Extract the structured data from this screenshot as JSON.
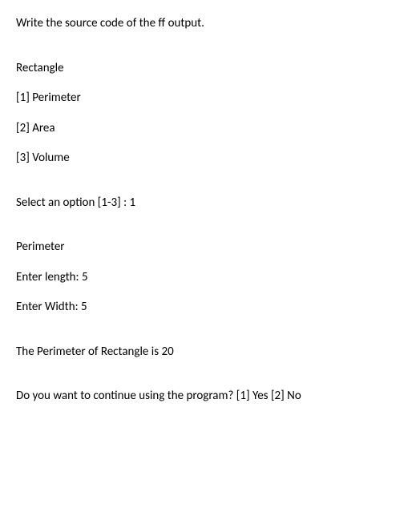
{
  "doc": {
    "instruction": "Write the source code of the ff output.",
    "menu_title": "Rectangle",
    "menu_items": [
      "[1] Perimeter",
      "[2] Area",
      "[3] Volume"
    ],
    "select_prompt": "Select an option [1-3] : 1",
    "selected_header": "Perimeter",
    "input_length": "Enter length: 5",
    "input_width": "Enter Width: 5",
    "result": "The Perimeter of Rectangle is 20",
    "continue_prompt": "Do you want to continue using the program? [1] Yes [2] No"
  }
}
